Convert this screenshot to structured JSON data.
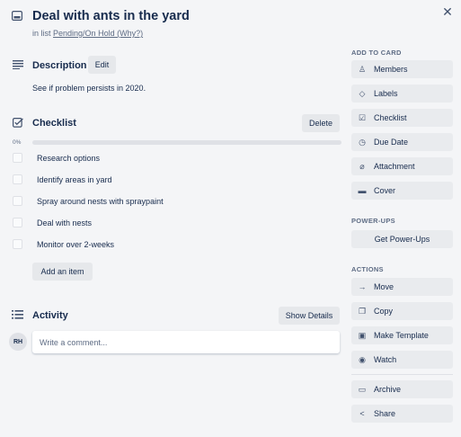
{
  "header": {
    "title": "Deal with ants in the yard",
    "in_list_prefix": "in list",
    "list_name": "Pending/On Hold (Why?)",
    "close_icon": "close-icon"
  },
  "description": {
    "heading": "Description",
    "edit_label": "Edit",
    "text": "See if problem persists in 2020."
  },
  "checklist": {
    "heading": "Checklist",
    "delete_label": "Delete",
    "progress_label": "0%",
    "progress": 0,
    "items": [
      {
        "label": "Research options",
        "checked": false
      },
      {
        "label": "Identify areas in yard",
        "checked": false
      },
      {
        "label": "Spray around nests with spraypaint",
        "checked": false
      },
      {
        "label": "Deal with nests",
        "checked": false
      },
      {
        "label": "Monitor over 2-weeks",
        "checked": false
      }
    ],
    "add_item_label": "Add an item"
  },
  "activity": {
    "heading": "Activity",
    "show_details_label": "Show Details",
    "avatar_initials": "RH",
    "comment_placeholder": "Write a comment..."
  },
  "sidebar": {
    "add_to_card_heading": "ADD TO CARD",
    "add_to_card": [
      {
        "label": "Members",
        "icon": "person-icon"
      },
      {
        "label": "Labels",
        "icon": "tag-icon"
      },
      {
        "label": "Checklist",
        "icon": "checklist-icon"
      },
      {
        "label": "Due Date",
        "icon": "clock-icon"
      },
      {
        "label": "Attachment",
        "icon": "paperclip-icon"
      },
      {
        "label": "Cover",
        "icon": "cover-icon"
      }
    ],
    "powerups_heading": "POWER-UPS",
    "get_powerups_label": "Get Power-Ups",
    "actions_heading": "ACTIONS",
    "actions": [
      {
        "label": "Move",
        "icon": "arrow-right-icon"
      },
      {
        "label": "Copy",
        "icon": "copy-icon"
      },
      {
        "label": "Make Template",
        "icon": "template-icon"
      },
      {
        "label": "Watch",
        "icon": "eye-icon"
      }
    ],
    "archive_label": "Archive",
    "share_label": "Share"
  }
}
